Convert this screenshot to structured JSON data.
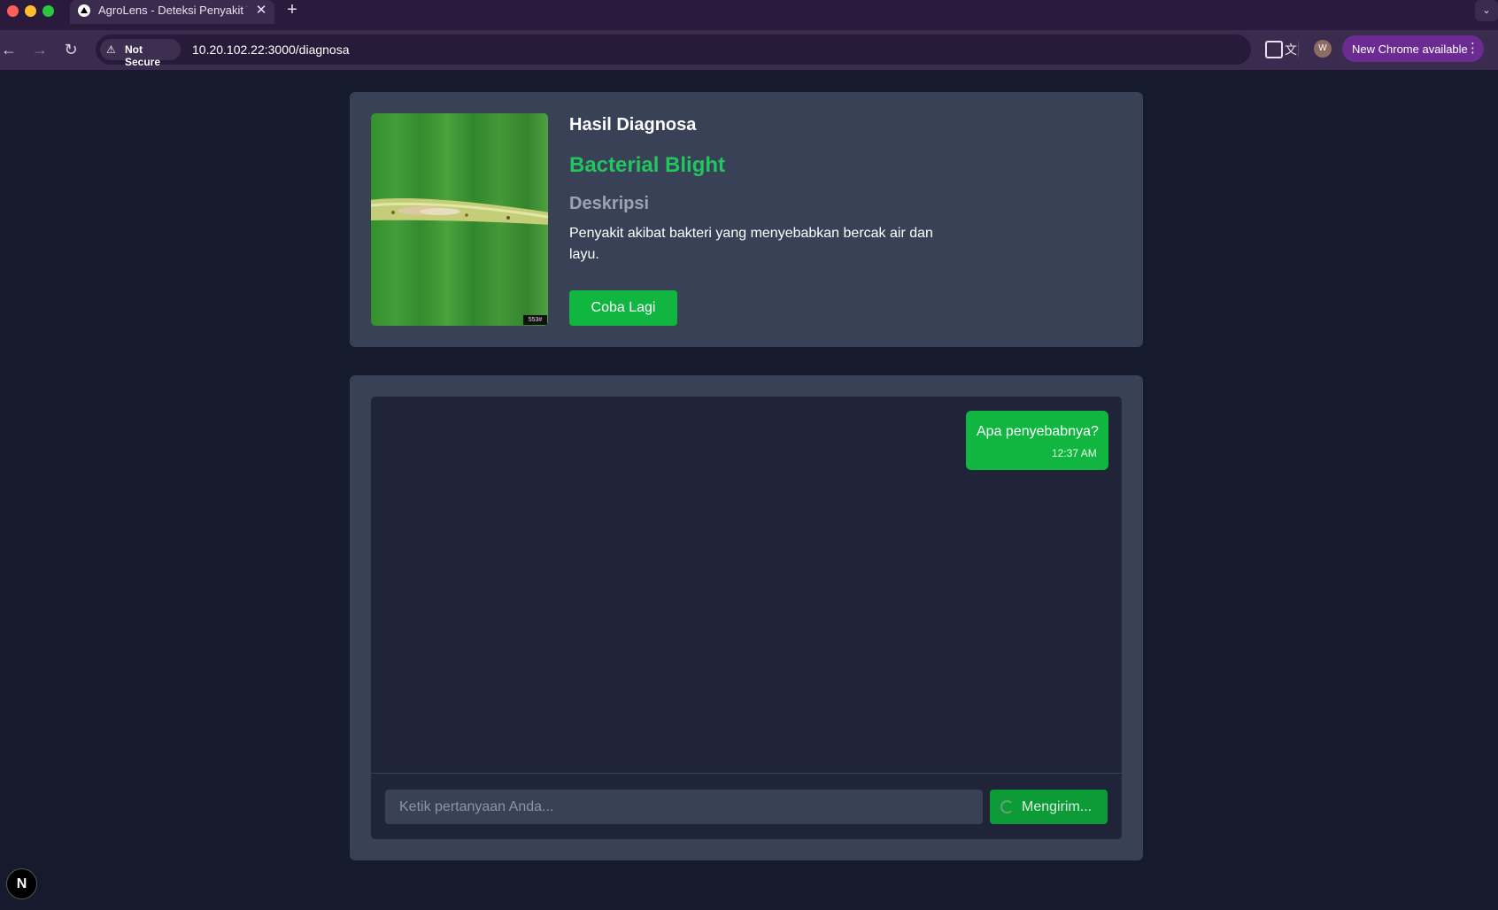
{
  "browser": {
    "tab_title": "AgroLens - Deteksi Penyakit T",
    "tab_close": "✕",
    "new_tab": "+",
    "security_label": "Not Secure",
    "url": "10.20.102.22:3000/diagnosa",
    "update_label": "New Chrome available",
    "avatar_initial": "W",
    "icons": [
      "back-icon",
      "forward-icon",
      "reload-icon",
      "warning-icon",
      "translate-icon",
      "star-icon",
      "extensions-icon",
      "more-icon"
    ]
  },
  "diagnosis": {
    "title": "Hasil Diagnosa",
    "disease": "Bacterial Blight",
    "description_heading": "Deskripsi",
    "description": "Penyakit akibat bakteri yang menyebabkan bercak air dan layu.",
    "retry_label": "Coba Lagi",
    "image_stamp": "553#",
    "accent_color": "#22c55e"
  },
  "chat": {
    "messages": [
      {
        "text": "Apa penyebabnya?",
        "time": "12:37 AM"
      }
    ],
    "input_placeholder": "Ketik pertanyaan Anda...",
    "send_label": "Mengirim..."
  },
  "dev_badge": "N"
}
